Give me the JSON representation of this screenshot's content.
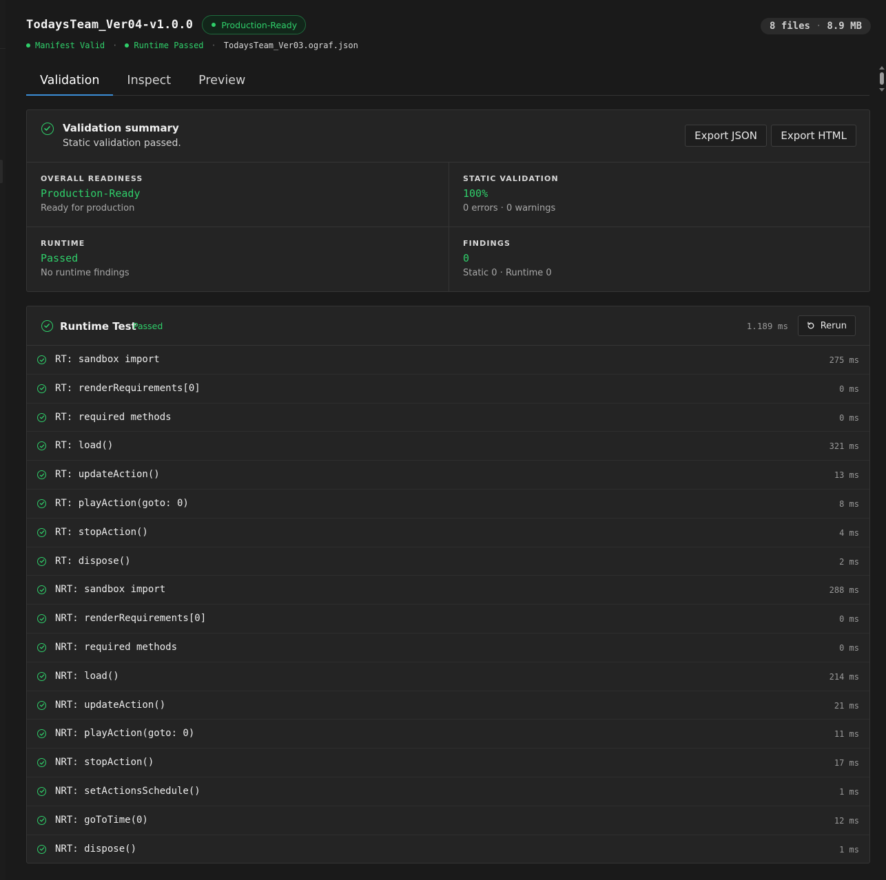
{
  "header": {
    "title": "TodaysTeam_Ver04-v1.0.0",
    "badge": "Production-Ready",
    "files_count": "8 files",
    "size": "8.9 MB",
    "manifest_status": "Manifest Valid",
    "runtime_status": "Runtime Passed",
    "source_file": "TodaysTeam_Ver03.ograf.json"
  },
  "tabs": [
    {
      "label": "Validation",
      "active": true
    },
    {
      "label": "Inspect",
      "active": false
    },
    {
      "label": "Preview",
      "active": false
    }
  ],
  "summary": {
    "title": "Validation summary",
    "subtitle": "Static validation passed.",
    "export_json_label": "Export JSON",
    "export_html_label": "Export HTML",
    "cells": {
      "readiness": {
        "label": "OVERALL READINESS",
        "value": "Production-Ready",
        "sub": "Ready for production"
      },
      "static": {
        "label": "STATIC VALIDATION",
        "value": "100%",
        "sub": "0 errors · 0 warnings"
      },
      "runtime": {
        "label": "RUNTIME",
        "value": "Passed",
        "sub": "No runtime findings"
      },
      "findings": {
        "label": "FINDINGS",
        "value": "0",
        "sub": "Static 0 · Runtime 0"
      }
    }
  },
  "runtime_test": {
    "title": "Runtime Test",
    "status": "Passed",
    "total": "1.189 ms",
    "rerun_label": "Rerun",
    "tests": [
      {
        "name": "RT: sandbox import",
        "time": "275 ms"
      },
      {
        "name": "RT: renderRequirements[0]",
        "time": "0 ms"
      },
      {
        "name": "RT: required methods",
        "time": "0 ms"
      },
      {
        "name": "RT: load()",
        "time": "321 ms"
      },
      {
        "name": "RT: updateAction()",
        "time": "13 ms"
      },
      {
        "name": "RT: playAction(goto: 0)",
        "time": "8 ms"
      },
      {
        "name": "RT: stopAction()",
        "time": "4 ms"
      },
      {
        "name": "RT: dispose()",
        "time": "2 ms"
      },
      {
        "name": "NRT: sandbox import",
        "time": "288 ms"
      },
      {
        "name": "NRT: renderRequirements[0]",
        "time": "0 ms"
      },
      {
        "name": "NRT: required methods",
        "time": "0 ms"
      },
      {
        "name": "NRT: load()",
        "time": "214 ms"
      },
      {
        "name": "NRT: updateAction()",
        "time": "21 ms"
      },
      {
        "name": "NRT: playAction(goto: 0)",
        "time": "11 ms"
      },
      {
        "name": "NRT: stopAction()",
        "time": "17 ms"
      },
      {
        "name": "NRT: setActionsSchedule()",
        "time": "1 ms"
      },
      {
        "name": "NRT: goToTime(0)",
        "time": "12 ms"
      },
      {
        "name": "NRT: dispose()",
        "time": "1 ms"
      }
    ]
  },
  "colors": {
    "accent_green": "#2fcf6a",
    "tab_underline": "#3b8ed8",
    "background": "#1a1a1a",
    "card": "#242424"
  },
  "icons": [
    "check-circle-icon",
    "rerun-icon",
    "status-dot-icon"
  ]
}
